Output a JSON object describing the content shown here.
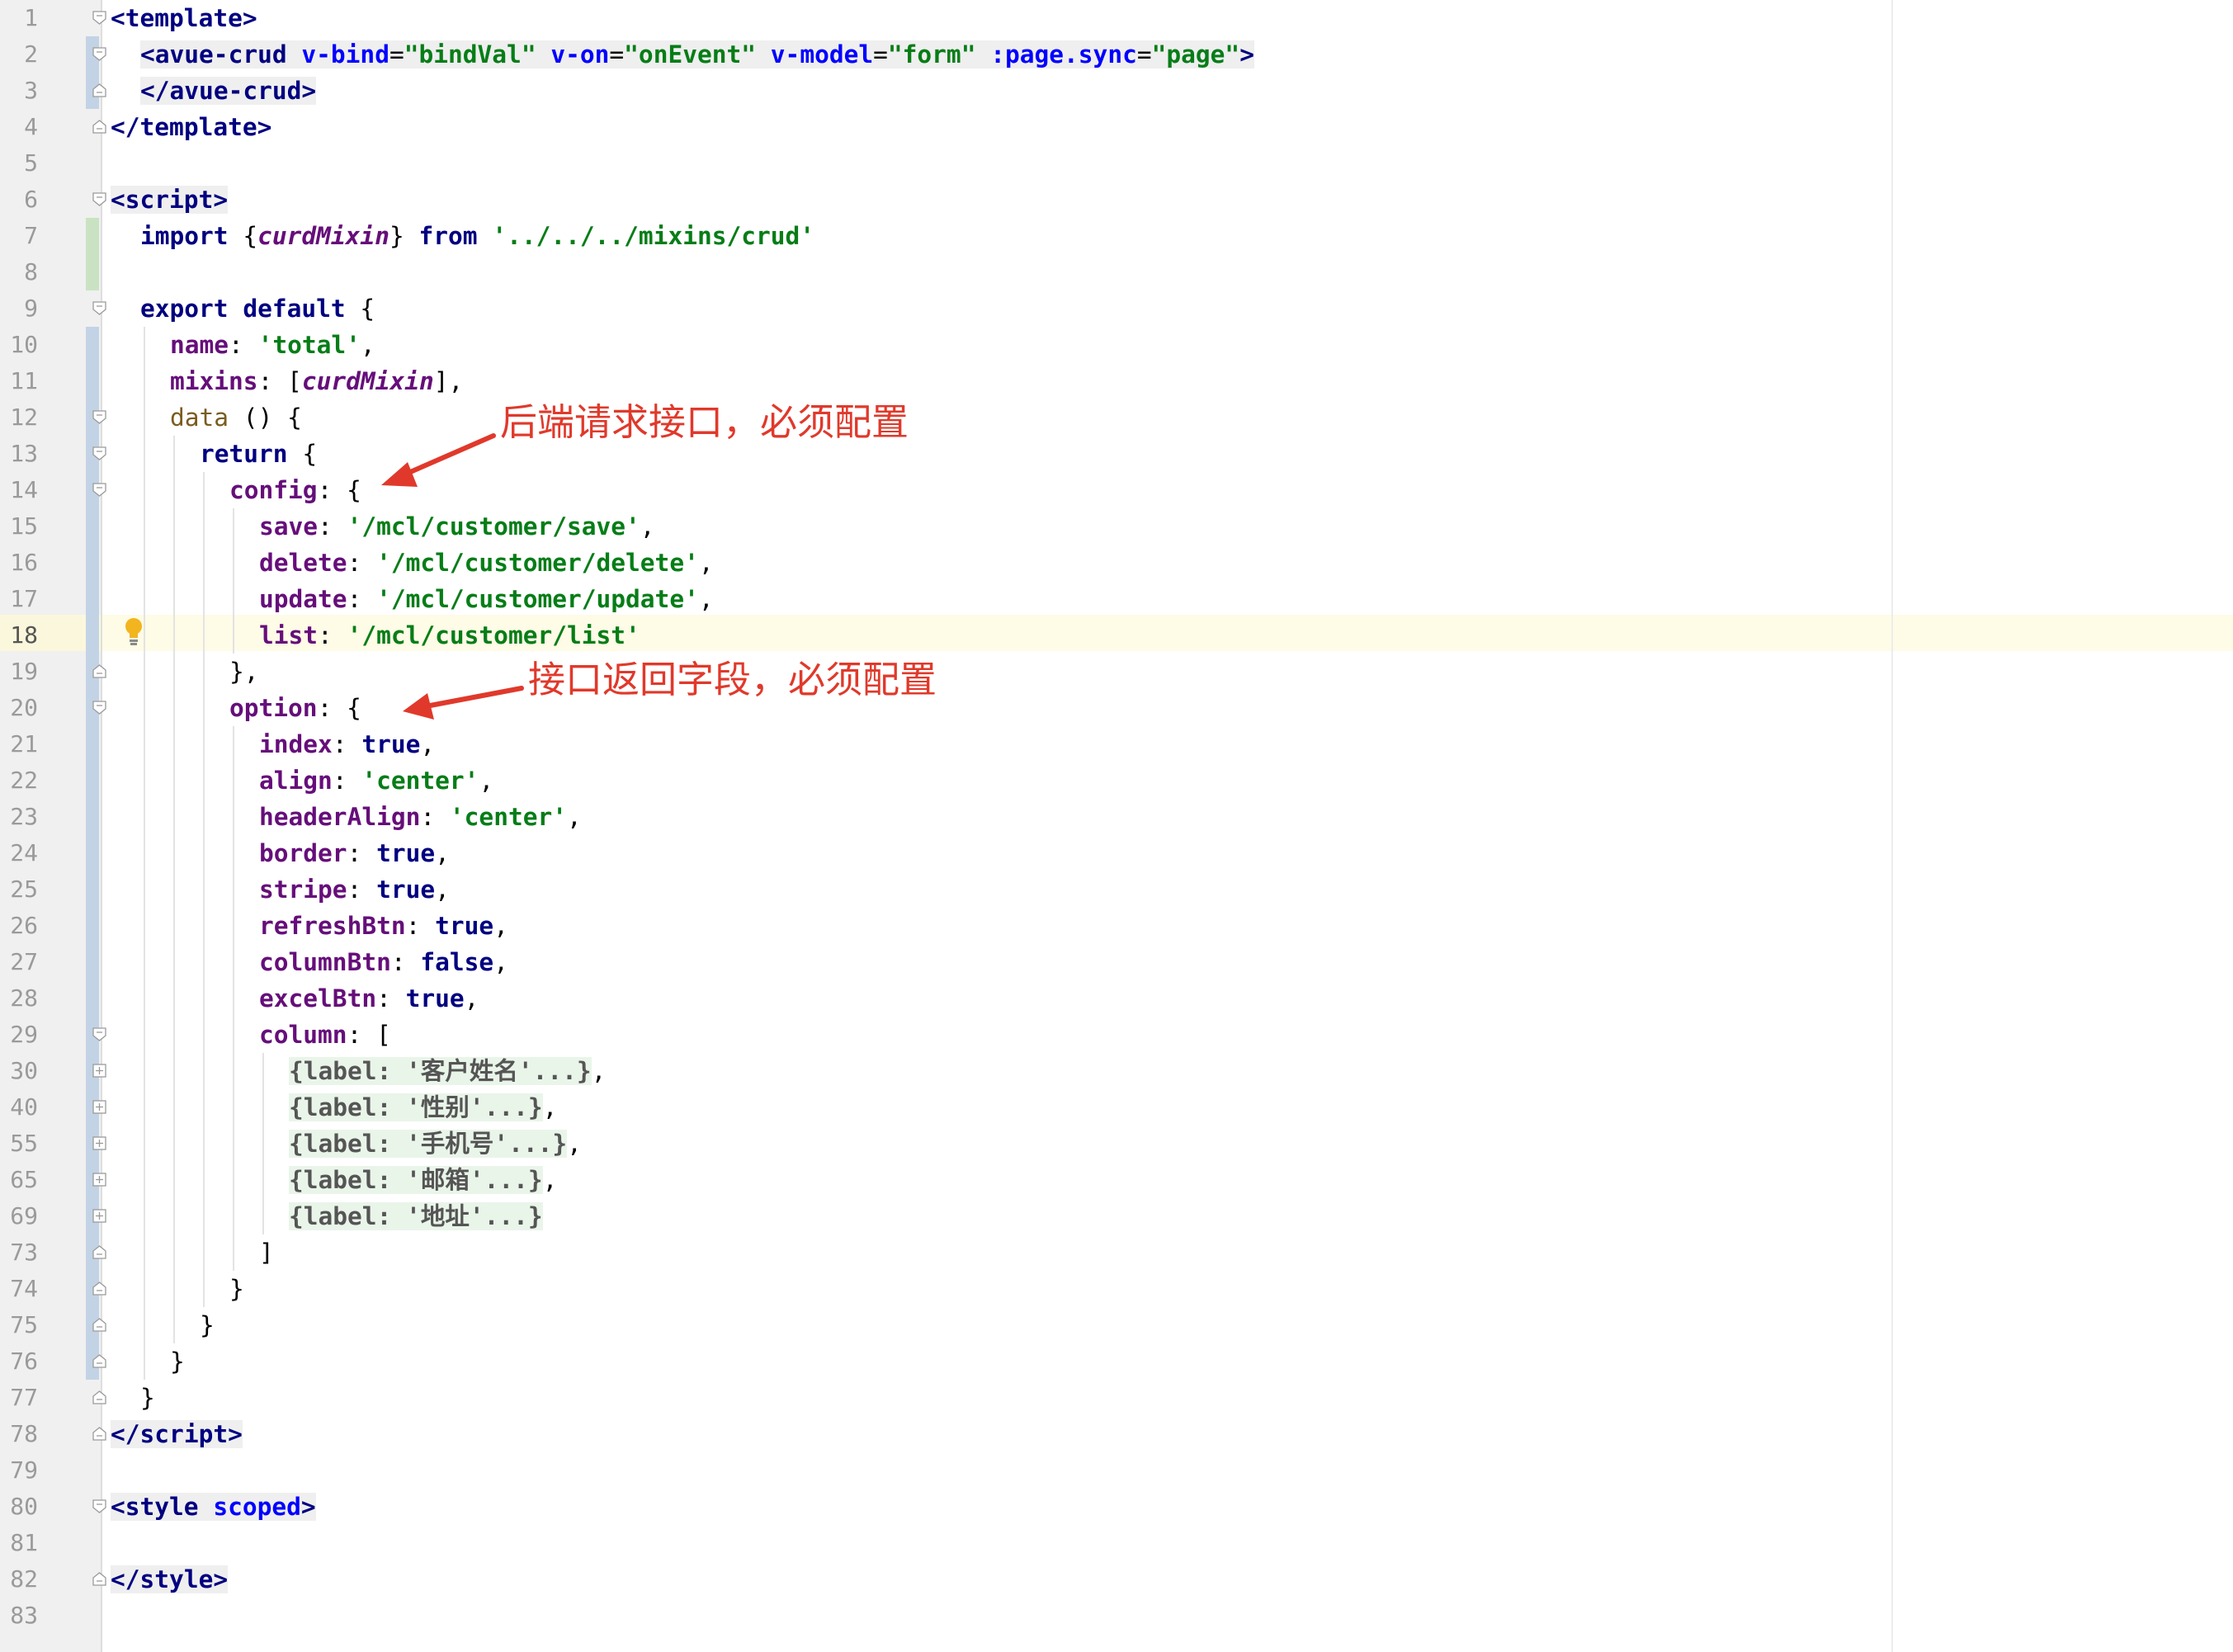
{
  "editor": {
    "line_numbers": [
      "1",
      "2",
      "3",
      "4",
      "5",
      "6",
      "7",
      "8",
      "9",
      "10",
      "11",
      "12",
      "13",
      "14",
      "15",
      "16",
      "17",
      "18",
      "19",
      "20",
      "21",
      "22",
      "23",
      "24",
      "25",
      "26",
      "27",
      "28",
      "29",
      "30",
      "40",
      "55",
      "65",
      "69",
      "73",
      "74",
      "75",
      "76",
      "77",
      "78",
      "79",
      "80",
      "81",
      "82",
      "83"
    ],
    "current_line": "18",
    "code": {
      "l1_template": "template",
      "l2_tag": "avue-crud",
      "l2_a1": "v-bind",
      "l2_v1": "\"bindVal\"",
      "l2_a2": "v-on",
      "l2_v2": "\"onEvent\"",
      "l2_a3": "v-model",
      "l2_v3": "\"form\"",
      "l2_a4": ":page.sync",
      "l2_v4": "\"page\"",
      "l3_tag": "avue-crud",
      "l4_tag": "template",
      "l6_tag": "script",
      "l7_import": "import",
      "l7_name": "curdMixin",
      "l7_from": "from",
      "l7_path": "'../../../mixins/crud'",
      "l9_export": "export",
      "l9_default": "default",
      "l10_key": "name",
      "l10_val": "'total'",
      "l11_key": "mixins",
      "l11_val": "curdMixin",
      "l12_key": "data",
      "l13_kw": "return",
      "l14_key": "config",
      "l15_key": "save",
      "l15_val": "'/mcl/customer/save'",
      "l16_key": "delete",
      "l16_val": "'/mcl/customer/delete'",
      "l17_key": "update",
      "l17_val": "'/mcl/customer/update'",
      "l18_key": "list",
      "l18_val": "'/mcl/customer/list'",
      "l20_key": "option",
      "l21_key": "index",
      "l21_val": "true",
      "l22_key": "align",
      "l22_val": "'center'",
      "l23_key": "headerAlign",
      "l23_val": "'center'",
      "l24_key": "border",
      "l24_val": "true",
      "l25_key": "stripe",
      "l25_val": "true",
      "l26_key": "refreshBtn",
      "l26_val": "true",
      "l27_key": "columnBtn",
      "l27_val": "false",
      "l28_key": "excelBtn",
      "l28_val": "true",
      "l29_key": "column",
      "l30_fold": "{label: '客户姓名'...}",
      "l40_fold": "{label: '性别'...}",
      "l55_fold": "{label: '手机号'...}",
      "l65_fold": "{label: '邮箱'...}",
      "l69_fold": "{label: '地址'...}",
      "l78_tag": "script",
      "l80_tag": "style",
      "l80_attr": "scoped",
      "l82_tag": "style"
    }
  },
  "annotations": {
    "first": "后端请求接口，必须配置",
    "second": "接口返回字段，必须配置"
  },
  "colors": {
    "annotation": "#e0392b",
    "string": "#067d17",
    "keyword": "#000080",
    "property": "#660e7a",
    "attribute": "#0000ff"
  }
}
